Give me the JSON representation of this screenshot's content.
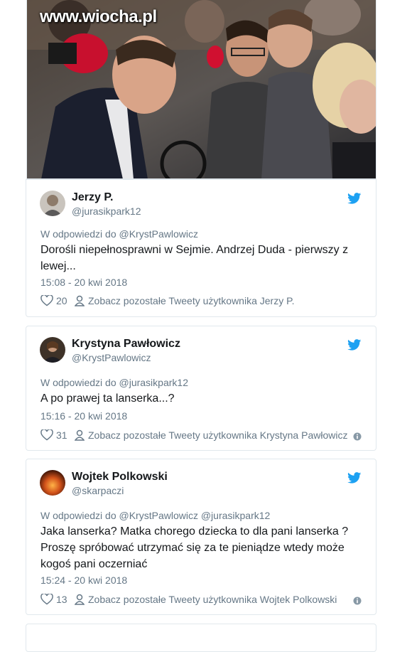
{
  "photo": {
    "watermark": "www.wiocha.pl"
  },
  "tweets": [
    {
      "name": "Jerzy P.",
      "handle": "@jurasikpark12",
      "reply_to": "W odpowiedzi do @KrystPawlowicz",
      "text_lines": [
        "Dorośli niepełnosprawni w Sejmie. Andrzej Duda - pierwszy z",
        "lewej..."
      ],
      "time": "15:08 - 20 kwi 2018",
      "likes": "20",
      "more_label": "Zobacz pozostałe Tweety użytkownika Jerzy P."
    },
    {
      "name": "Krystyna Pawłowicz",
      "handle": "@KrystPawlowicz",
      "reply_to": "W odpowiedzi do @jurasikpark12",
      "text_lines": [
        "A po prawej ta lanserka...?"
      ],
      "time": "15:16 - 20 kwi 2018",
      "likes": "31",
      "more_label": "Zobacz pozostałe Tweety użytkownika Krystyna Pawłowicz"
    },
    {
      "name": "Wojtek Polkowski",
      "handle": "@skarpaczi",
      "reply_to": "W odpowiedzi do @KrystPawlowicz @jurasikpark12",
      "text_lines": [
        "Jaka lanserka? Matka chorego dziecka to dla pani lanserka ?",
        "Proszę spróbować utrzymać się za te pieniądze wtedy może",
        "kogoś pani oczerniać"
      ],
      "time": "15:24 - 20 kwi 2018",
      "likes": "13",
      "more_label": "Zobacz pozostałe Tweety użytkownika Wojtek Polkowski"
    }
  ],
  "colors": {
    "twitter_blue": "#1da1f2",
    "muted": "#657786",
    "border": "#e1e8ed"
  }
}
